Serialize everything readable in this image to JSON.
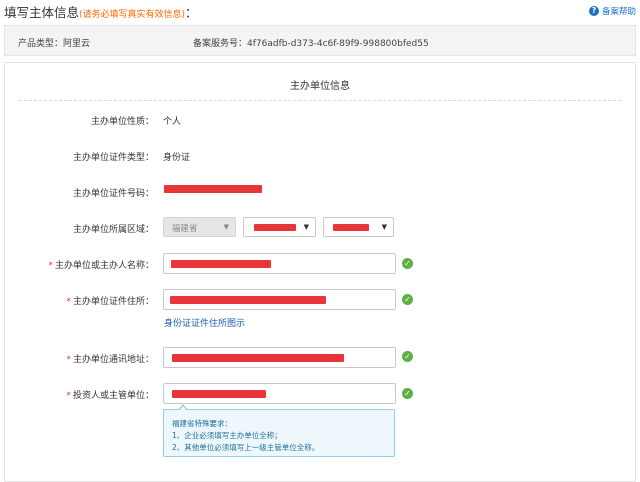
{
  "header": {
    "title": "填写主体信息",
    "hint": "(请务必填写真实有效信息)",
    "colon": "：",
    "help_label": "备案帮助"
  },
  "info": {
    "product_type": "产品类型：阿里云",
    "service_no_label": "备案服务号：",
    "service_no": "4f76adfb-d373-4c6f-89f9-998800bfed55"
  },
  "section": {
    "title": "主办单位信息"
  },
  "form": {
    "nature": {
      "label": "主办单位性质：",
      "value": "个人"
    },
    "id_type": {
      "label": "主办单位证件类型：",
      "value": "身份证"
    },
    "id_no": {
      "label": "主办单位证件号码："
    },
    "region": {
      "label": "主办单位所属区域：",
      "province": "福建省"
    },
    "name": {
      "label": "主办单位或主办人名称：",
      "required": "*"
    },
    "id_address": {
      "label": "主办单位证件住所：",
      "required": "*",
      "link": "身份证证件住所图示"
    },
    "contact_address": {
      "label": "主办单位通讯地址：",
      "required": "*"
    },
    "investor": {
      "label": "投资人或主管单位：",
      "required": "*"
    }
  },
  "tip": {
    "title": "福建省特殊要求：",
    "line1": "1、企业必须填写主办单位全称；",
    "line2": "2、其他单位必须填写上一级主管单位全称。"
  },
  "colors": {
    "accent": "#1b72c4",
    "hint": "#ff6600",
    "success": "#5db043",
    "required": "#e4393c"
  }
}
